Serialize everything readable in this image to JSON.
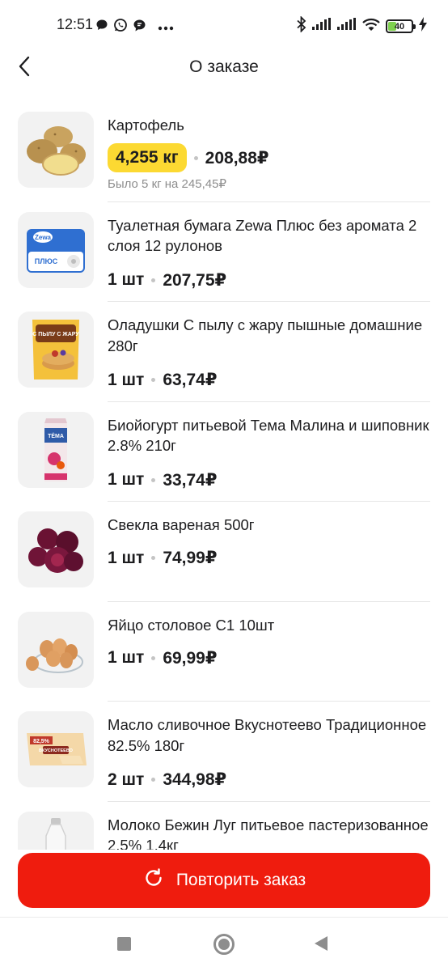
{
  "status_bar": {
    "time": "12:51",
    "left_icons": [
      "chat-bubble-icon",
      "whatsapp-icon",
      "message-icon",
      "more-dots-icon"
    ],
    "right_icons": [
      "bluetooth-icon",
      "signal-icon",
      "signal-icon",
      "wifi-icon",
      "battery-icon",
      "charging-icon"
    ],
    "battery": "40",
    "battery_fill": 0.4
  },
  "header": {
    "title": "О заказе",
    "back_icon": "chevron-left-icon"
  },
  "colors": {
    "accent_red": "#ef1c0e",
    "badge_yellow": "#fcd932",
    "battery_green": "#7fd14f",
    "muted_text": "#8d8d8d"
  },
  "items": [
    {
      "name": "Картофель",
      "qty": "4,255 кг",
      "price": "208,88₽",
      "was": "Было 5 кг на 245,45₽",
      "image": "potato-image"
    },
    {
      "name": "Туалетная бумага Zewa Плюс без аромата 2 слоя 12 рулонов",
      "qty": "1 шт",
      "price": "207,75₽",
      "image": "toilet-paper-image"
    },
    {
      "name": "Оладушки С пылу с жару пышные домашние 280г",
      "qty": "1 шт",
      "price": "63,74₽",
      "image": "pancakes-image"
    },
    {
      "name": "Биойогурт питьевой Тема Малина и шиповник 2.8% 210г",
      "qty": "1 шт",
      "price": "33,74₽",
      "image": "yogurt-image"
    },
    {
      "name": "Свекла вареная 500г",
      "qty": "1 шт",
      "price": "74,99₽",
      "image": "beetroot-image"
    },
    {
      "name": "Яйцо столовое С1 10шт",
      "qty": "1 шт",
      "price": "69,99₽",
      "image": "eggs-image"
    },
    {
      "name": "Масло сливочное Вкуснотеево Традиционное 82.5% 180г",
      "qty": "2 шт",
      "price": "344,98₽",
      "image": "butter-image"
    },
    {
      "name": "Молоко Бежин Луг питьевое пастеризованное 2.5% 1,4кг",
      "qty": "",
      "price": "",
      "image": "milk-image"
    }
  ],
  "product_image_text": {
    "toilet_paper_brand": "Zewa",
    "toilet_paper_variant": "ПЛЮС",
    "pancakes_brand": "С ПЫЛУ С ЖАРУ",
    "yogurt_brand": "ТЁМА",
    "butter_fat": "82,5%",
    "butter_brand": "ВКУСНОТЕЕВО"
  },
  "repeat_button": {
    "label": "Повторить заказ",
    "icon": "repeat-icon"
  },
  "nav_bar": {
    "icons": [
      "recent-apps-icon",
      "home-icon",
      "back-icon"
    ]
  }
}
